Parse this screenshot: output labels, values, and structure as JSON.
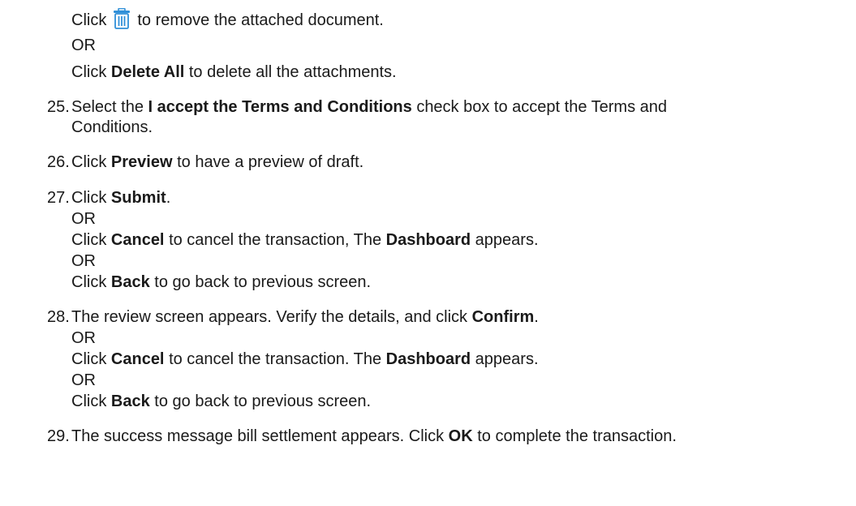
{
  "intro": {
    "click_word": "Click",
    "icon": "trash-icon",
    "remove_text": "to remove the attached document.",
    "or1": "OR",
    "click_word2": "Click",
    "delete_all": "Delete All",
    "delete_all_text": "to delete all the attachments."
  },
  "steps": [
    {
      "number": "25.",
      "pre": "Select the",
      "bold": "I accept the Terms and Conditions",
      "post": "check box to accept the Terms and",
      "cont": "Conditions."
    },
    {
      "number": "26.",
      "pre": "Click",
      "bold": "Preview",
      "post": "to have a preview of draft."
    },
    {
      "number": "27.",
      "pre": "Click",
      "bold": "Submit",
      "post": ".",
      "or1": "OR",
      "alt1_pre": "Click",
      "alt1_bold": "Cancel",
      "alt1_mid": "to cancel the transaction, The",
      "alt1_bold2": "Dashboard",
      "alt1_post": "appears.",
      "or2": "OR",
      "alt2_pre": "Click",
      "alt2_bold": "Back",
      "alt2_post": "to go back to previous screen."
    },
    {
      "number": "28.",
      "pre": "The review screen appears. Verify the details, and click",
      "bold": "Confirm",
      "post": ".",
      "or1": "OR",
      "alt1_pre": "Click",
      "alt1_bold": "Cancel",
      "alt1_mid": "to cancel the transaction. The",
      "alt1_bold2": "Dashboard",
      "alt1_post": "appears.",
      "or2": "OR",
      "alt2_pre": "Click",
      "alt2_bold": "Back",
      "alt2_post": "to go back to previous screen."
    },
    {
      "number": "29.",
      "pre": "The success message bill settlement appears. Click",
      "bold": "OK",
      "post": "to complete the transaction."
    }
  ],
  "colors": {
    "text": "#1a1a1a",
    "icon_blue": "#2f8fd8"
  }
}
